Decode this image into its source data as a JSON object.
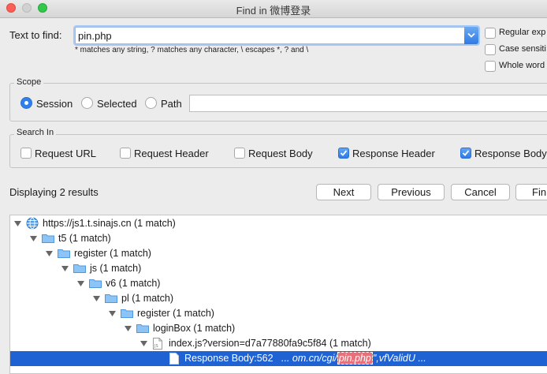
{
  "window": {
    "title": "Find in 微博登录"
  },
  "find": {
    "label": "Text to find:",
    "value": "pin.php",
    "hint": "* matches any string, ? matches any character, \\ escapes *, ? and \\"
  },
  "options": [
    {
      "label": "Regular exp",
      "checked": false
    },
    {
      "label": "Case sensiti",
      "checked": false
    },
    {
      "label": "Whole word",
      "checked": false
    }
  ],
  "scope": {
    "title": "Scope",
    "options": [
      {
        "label": "Session",
        "selected": true
      },
      {
        "label": "Selected",
        "selected": false
      },
      {
        "label": "Path",
        "selected": false
      }
    ],
    "path_value": ""
  },
  "search_in": {
    "title": "Search In",
    "options": [
      {
        "label": "Request URL",
        "checked": false
      },
      {
        "label": "Request Header",
        "checked": false
      },
      {
        "label": "Request Body",
        "checked": false
      },
      {
        "label": "Response Header",
        "checked": true
      },
      {
        "label": "Response Body",
        "checked": true
      }
    ]
  },
  "results": {
    "status": "Displaying 2 results"
  },
  "buttons": {
    "next": "Next",
    "previous": "Previous",
    "cancel": "Cancel",
    "find": "Fin"
  },
  "tree": [
    {
      "text": "https://js1.t.sinajs.cn (1 match)",
      "icon": "globe-icon"
    },
    {
      "text": "t5 (1 match)",
      "icon": "folder-icon"
    },
    {
      "text": "register (1 match)",
      "icon": "folder-icon"
    },
    {
      "text": "js (1 match)",
      "icon": "folder-icon"
    },
    {
      "text": "v6 (1 match)",
      "icon": "folder-icon"
    },
    {
      "text": "pl (1 match)",
      "icon": "folder-icon"
    },
    {
      "text": "register (1 match)",
      "icon": "folder-icon"
    },
    {
      "text": "loginBox (1 match)",
      "icon": "folder-icon"
    },
    {
      "text": "index.js?version=d7a77880fa9c5f84 (1 match)",
      "icon": "js-file-icon"
    },
    {
      "label": "Response Body:562",
      "before": "... om.cn/cgi/",
      "match": "pin.php",
      "after": "\",vfValidU ...",
      "icon": "document-icon"
    }
  ],
  "colors": {
    "accent": "#2f80ec",
    "selection": "#1f62d3",
    "match_highlight": "#e8707b"
  }
}
